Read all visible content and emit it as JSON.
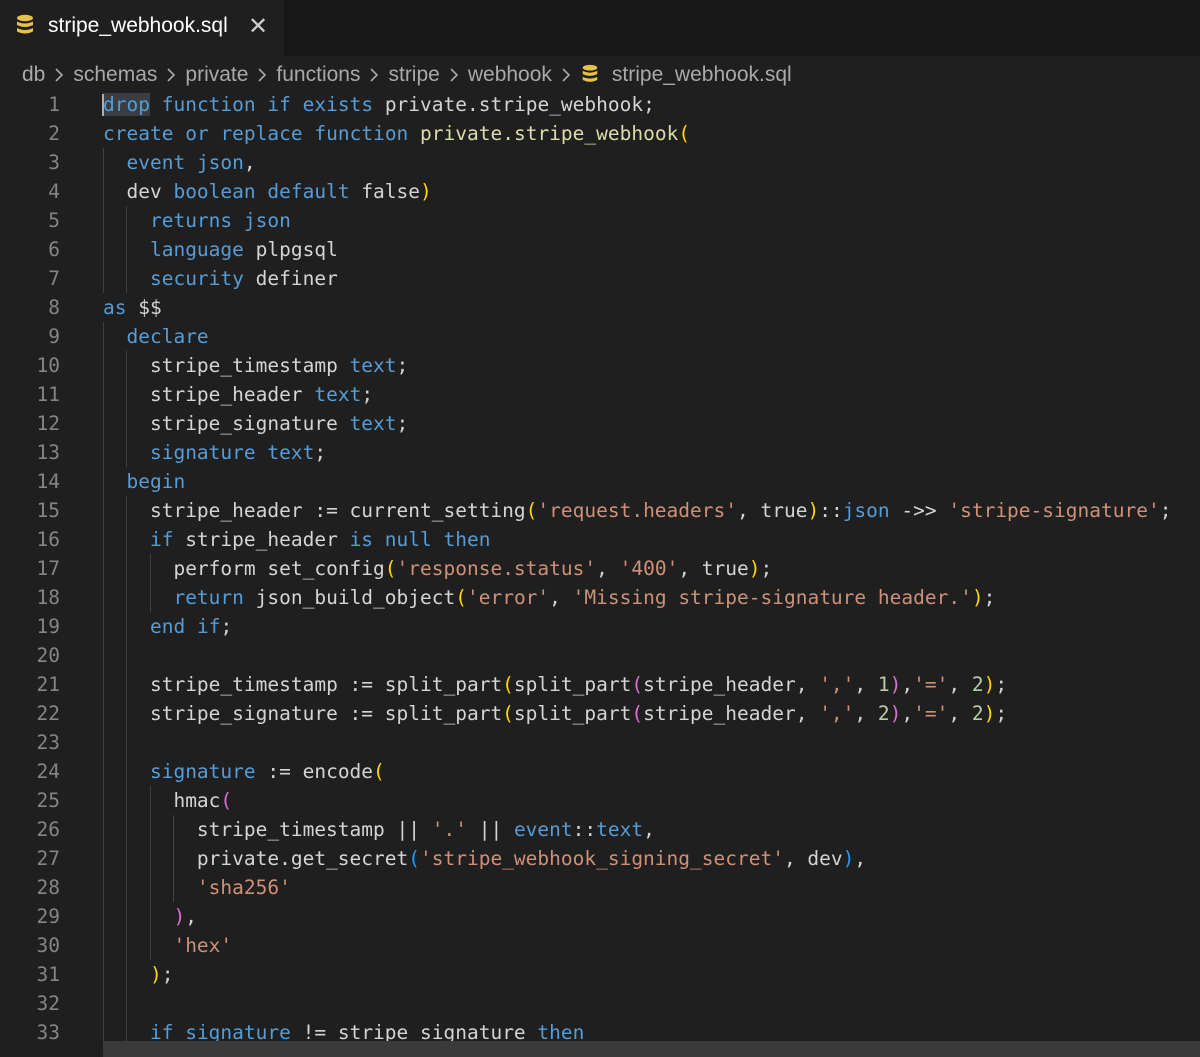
{
  "tab": {
    "filename": "stripe_webhook.sql",
    "close": "✕",
    "icon": "database-icon"
  },
  "breadcrumb": {
    "items": [
      "db",
      "schemas",
      "private",
      "functions",
      "stripe",
      "webhook"
    ],
    "file": "stripe_webhook.sql",
    "separator": "chevron-right-icon"
  },
  "colors": {
    "keyword": "#569cd6",
    "function": "#dcdcaa",
    "string": "#ce9178",
    "number": "#b5cea8",
    "plain": "#d4d4d4",
    "bracket1": "#ffd700",
    "bracket2": "#da70d6",
    "bracket3": "#179fff",
    "icon": "#e8c146"
  },
  "lines": [
    {
      "n": "1",
      "indent": 0,
      "tokens": [
        [
          "kw",
          "drop"
        ],
        [
          "pl",
          " "
        ],
        [
          "kw",
          "function"
        ],
        [
          "pl",
          " "
        ],
        [
          "kw",
          "if"
        ],
        [
          "pl",
          " "
        ],
        [
          "kw",
          "exists"
        ],
        [
          "pl",
          " private.stripe_webhook;"
        ]
      ]
    },
    {
      "n": "2",
      "indent": 0,
      "tokens": [
        [
          "kw",
          "create"
        ],
        [
          "pl",
          " "
        ],
        [
          "kw",
          "or"
        ],
        [
          "pl",
          " "
        ],
        [
          "kw",
          "replace"
        ],
        [
          "pl",
          " "
        ],
        [
          "kw",
          "function"
        ],
        [
          "pl",
          " "
        ],
        [
          "fn",
          "private.stripe_webhook"
        ],
        [
          "b1",
          "("
        ]
      ]
    },
    {
      "n": "3",
      "indent": 1,
      "tokens": [
        [
          "kw",
          "event"
        ],
        [
          "pl",
          " "
        ],
        [
          "kw",
          "json"
        ],
        [
          "pl",
          ","
        ]
      ]
    },
    {
      "n": "4",
      "indent": 1,
      "tokens": [
        [
          "pl",
          "dev "
        ],
        [
          "kw",
          "boolean"
        ],
        [
          "pl",
          " "
        ],
        [
          "kw",
          "default"
        ],
        [
          "pl",
          " false"
        ],
        [
          "b1",
          ")"
        ]
      ]
    },
    {
      "n": "5",
      "indent": 2,
      "tokens": [
        [
          "kw",
          "returns"
        ],
        [
          "pl",
          " "
        ],
        [
          "kw",
          "json"
        ]
      ]
    },
    {
      "n": "6",
      "indent": 2,
      "tokens": [
        [
          "kw",
          "language"
        ],
        [
          "pl",
          " plpgsql"
        ]
      ]
    },
    {
      "n": "7",
      "indent": 2,
      "tokens": [
        [
          "kw",
          "security"
        ],
        [
          "pl",
          " definer"
        ]
      ]
    },
    {
      "n": "8",
      "indent": 0,
      "tokens": [
        [
          "kw",
          "as"
        ],
        [
          "pl",
          " $$"
        ]
      ]
    },
    {
      "n": "9",
      "indent": 1,
      "tokens": [
        [
          "kw",
          "declare"
        ]
      ]
    },
    {
      "n": "10",
      "indent": 2,
      "tokens": [
        [
          "pl",
          "stripe_timestamp "
        ],
        [
          "kw",
          "text"
        ],
        [
          "pl",
          ";"
        ]
      ]
    },
    {
      "n": "11",
      "indent": 2,
      "tokens": [
        [
          "pl",
          "stripe_header "
        ],
        [
          "kw",
          "text"
        ],
        [
          "pl",
          ";"
        ]
      ]
    },
    {
      "n": "12",
      "indent": 2,
      "tokens": [
        [
          "pl",
          "stripe_signature "
        ],
        [
          "kw",
          "text"
        ],
        [
          "pl",
          ";"
        ]
      ]
    },
    {
      "n": "13",
      "indent": 2,
      "tokens": [
        [
          "kw",
          "signature"
        ],
        [
          "pl",
          " "
        ],
        [
          "kw",
          "text"
        ],
        [
          "pl",
          ";"
        ]
      ]
    },
    {
      "n": "14",
      "indent": 1,
      "tokens": [
        [
          "kw",
          "begin"
        ]
      ]
    },
    {
      "n": "15",
      "indent": 2,
      "tokens": [
        [
          "pl",
          "stripe_header := current_setting"
        ],
        [
          "b1",
          "("
        ],
        [
          "str",
          "'request.headers'"
        ],
        [
          "pl",
          ", true"
        ],
        [
          "b1",
          ")"
        ],
        [
          "pl",
          "::"
        ],
        [
          "kw",
          "json"
        ],
        [
          "pl",
          " ->> "
        ],
        [
          "str",
          "'stripe-signature'"
        ],
        [
          "pl",
          ";"
        ]
      ]
    },
    {
      "n": "16",
      "indent": 2,
      "tokens": [
        [
          "kw",
          "if"
        ],
        [
          "pl",
          " stripe_header "
        ],
        [
          "kw",
          "is"
        ],
        [
          "pl",
          " "
        ],
        [
          "kw",
          "null"
        ],
        [
          "pl",
          " "
        ],
        [
          "kw",
          "then"
        ]
      ]
    },
    {
      "n": "17",
      "indent": 3,
      "tokens": [
        [
          "pl",
          "perform set_config"
        ],
        [
          "b1",
          "("
        ],
        [
          "str",
          "'response.status'"
        ],
        [
          "pl",
          ", "
        ],
        [
          "str",
          "'400'"
        ],
        [
          "pl",
          ", true"
        ],
        [
          "b1",
          ")"
        ],
        [
          "pl",
          ";"
        ]
      ]
    },
    {
      "n": "18",
      "indent": 3,
      "tokens": [
        [
          "kw",
          "return"
        ],
        [
          "pl",
          " json_build_object"
        ],
        [
          "b1",
          "("
        ],
        [
          "str",
          "'error'"
        ],
        [
          "pl",
          ", "
        ],
        [
          "str",
          "'Missing stripe-signature header.'"
        ],
        [
          "b1",
          ")"
        ],
        [
          "pl",
          ";"
        ]
      ]
    },
    {
      "n": "19",
      "indent": 2,
      "tokens": [
        [
          "kw",
          "end"
        ],
        [
          "pl",
          " "
        ],
        [
          "kw",
          "if"
        ],
        [
          "pl",
          ";"
        ]
      ]
    },
    {
      "n": "20",
      "indent": 2,
      "tokens": []
    },
    {
      "n": "21",
      "indent": 2,
      "tokens": [
        [
          "pl",
          "stripe_timestamp := split_part"
        ],
        [
          "b1",
          "("
        ],
        [
          "pl",
          "split_part"
        ],
        [
          "b2",
          "("
        ],
        [
          "pl",
          "stripe_header, "
        ],
        [
          "str",
          "','"
        ],
        [
          "pl",
          ", "
        ],
        [
          "num",
          "1"
        ],
        [
          "b2",
          ")"
        ],
        [
          "pl",
          ","
        ],
        [
          "str",
          "'='"
        ],
        [
          "pl",
          ", "
        ],
        [
          "num",
          "2"
        ],
        [
          "b1",
          ")"
        ],
        [
          "pl",
          ";"
        ]
      ]
    },
    {
      "n": "22",
      "indent": 2,
      "tokens": [
        [
          "pl",
          "stripe_signature := split_part"
        ],
        [
          "b1",
          "("
        ],
        [
          "pl",
          "split_part"
        ],
        [
          "b2",
          "("
        ],
        [
          "pl",
          "stripe_header, "
        ],
        [
          "str",
          "','"
        ],
        [
          "pl",
          ", "
        ],
        [
          "num",
          "2"
        ],
        [
          "b2",
          ")"
        ],
        [
          "pl",
          ","
        ],
        [
          "str",
          "'='"
        ],
        [
          "pl",
          ", "
        ],
        [
          "num",
          "2"
        ],
        [
          "b1",
          ")"
        ],
        [
          "pl",
          ";"
        ]
      ]
    },
    {
      "n": "23",
      "indent": 2,
      "tokens": []
    },
    {
      "n": "24",
      "indent": 2,
      "tokens": [
        [
          "kw",
          "signature"
        ],
        [
          "pl",
          " := encode"
        ],
        [
          "b1",
          "("
        ]
      ]
    },
    {
      "n": "25",
      "indent": 3,
      "tokens": [
        [
          "pl",
          "hmac"
        ],
        [
          "b2",
          "("
        ]
      ]
    },
    {
      "n": "26",
      "indent": 4,
      "tokens": [
        [
          "pl",
          "stripe_timestamp || "
        ],
        [
          "str",
          "'.'"
        ],
        [
          "pl",
          " || "
        ],
        [
          "kw",
          "event"
        ],
        [
          "pl",
          "::"
        ],
        [
          "kw",
          "text"
        ],
        [
          "pl",
          ","
        ]
      ]
    },
    {
      "n": "27",
      "indent": 4,
      "tokens": [
        [
          "pl",
          "private.get_secret"
        ],
        [
          "b3",
          "("
        ],
        [
          "str",
          "'stripe_webhook_signing_secret'"
        ],
        [
          "pl",
          ", dev"
        ],
        [
          "b3",
          ")"
        ],
        [
          "pl",
          ","
        ]
      ]
    },
    {
      "n": "28",
      "indent": 4,
      "tokens": [
        [
          "str",
          "'sha256'"
        ]
      ]
    },
    {
      "n": "29",
      "indent": 3,
      "tokens": [
        [
          "b2",
          ")"
        ],
        [
          "pl",
          ","
        ]
      ]
    },
    {
      "n": "30",
      "indent": 3,
      "tokens": [
        [
          "str",
          "'hex'"
        ]
      ]
    },
    {
      "n": "31",
      "indent": 2,
      "tokens": [
        [
          "b1",
          ")"
        ],
        [
          "pl",
          ";"
        ]
      ]
    },
    {
      "n": "32",
      "indent": 2,
      "tokens": []
    },
    {
      "n": "33",
      "indent": 2,
      "tokens": [
        [
          "kw",
          "if"
        ],
        [
          "pl",
          " "
        ],
        [
          "kw",
          "signature"
        ],
        [
          "pl",
          " != stripe_signature "
        ],
        [
          "kw",
          "then"
        ]
      ]
    }
  ]
}
